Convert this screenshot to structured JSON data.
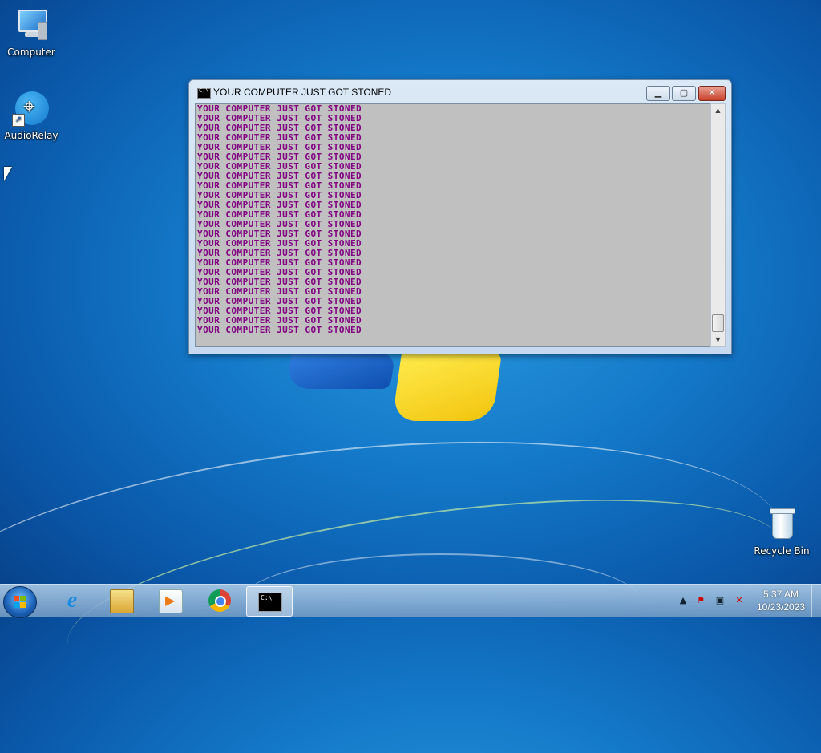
{
  "desktop": {
    "icons": [
      {
        "label": "Computer",
        "icon": "computer-icon"
      },
      {
        "label": "AudioRelay",
        "icon": "audiorelay-icon"
      },
      {
        "label": "Recycle Bin",
        "icon": "recycle-bin-icon"
      }
    ]
  },
  "window": {
    "title": "YOUR COMPUTER JUST GOT STONED",
    "icon": "console-icon",
    "buttons": {
      "minimize": "▁",
      "maximize": "▢",
      "close": "✕"
    },
    "console_lines": [
      "YOUR COMPUTER JUST GOT STONED",
      "YOUR COMPUTER JUST GOT STONED",
      "YOUR COMPUTER JUST GOT STONED",
      "YOUR COMPUTER JUST GOT STONED",
      "YOUR COMPUTER JUST GOT STONED",
      "YOUR COMPUTER JUST GOT STONED",
      "YOUR COMPUTER JUST GOT STONED",
      "YOUR COMPUTER JUST GOT STONED",
      "YOUR COMPUTER JUST GOT STONED",
      "YOUR COMPUTER JUST GOT STONED",
      "YOUR COMPUTER JUST GOT STONED",
      "YOUR COMPUTER JUST GOT STONED",
      "YOUR COMPUTER JUST GOT STONED",
      "YOUR COMPUTER JUST GOT STONED",
      "YOUR COMPUTER JUST GOT STONED",
      "YOUR COMPUTER JUST GOT STONED",
      "YOUR COMPUTER JUST GOT STONED",
      "YOUR COMPUTER JUST GOT STONED",
      "YOUR COMPUTER JUST GOT STONED",
      "YOUR COMPUTER JUST GOT STONED",
      "YOUR COMPUTER JUST GOT STONED",
      "YOUR COMPUTER JUST GOT STONED",
      "YOUR COMPUTER JUST GOT STONED",
      "YOUR COMPUTER JUST GOT STONED"
    ],
    "colors": {
      "console_bg": "#c0c0c0",
      "console_text": "#800080"
    }
  },
  "taskbar": {
    "items": [
      "start-icon",
      "internet-explorer-icon",
      "file-explorer-icon",
      "media-player-icon",
      "chrome-icon",
      "command-prompt-icon"
    ],
    "tray": {
      "show_hidden": "▲",
      "icons": [
        "action-center-icon",
        "network-icon",
        "volume-muted-icon"
      ]
    },
    "clock": {
      "time": "5:37 AM",
      "date": "10/23/2023"
    }
  }
}
